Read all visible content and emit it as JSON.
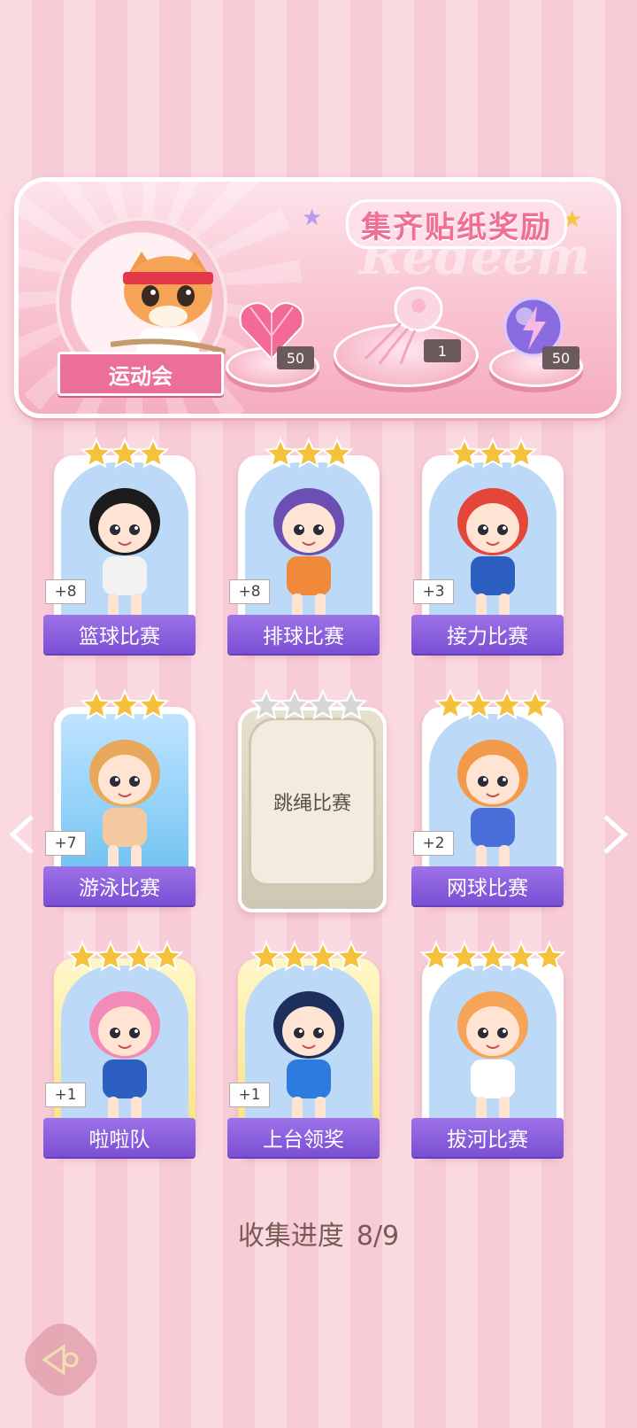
{
  "banner": {
    "title": "集齐贴纸奖励",
    "watermark": "Redeem",
    "event_name": "运动会",
    "rewards": [
      {
        "icon": "pink-heart-gem-icon",
        "count": "50"
      },
      {
        "icon": "jellyfish-ornament-icon",
        "count": "1"
      },
      {
        "icon": "lightning-orb-icon",
        "count": "50"
      }
    ]
  },
  "cards": [
    {
      "name": "篮球比赛",
      "bonus": "+8",
      "stars": 3,
      "filled": 3,
      "state": "collected"
    },
    {
      "name": "排球比赛",
      "bonus": "+8",
      "stars": 3,
      "filled": 3,
      "state": "collected"
    },
    {
      "name": "接力比赛",
      "bonus": "+3",
      "stars": 3,
      "filled": 3,
      "state": "collected"
    },
    {
      "name": "游泳比赛",
      "bonus": "+7",
      "stars": 3,
      "filled": 3,
      "state": "collected"
    },
    {
      "name": "跳绳比赛",
      "bonus": "",
      "stars": 4,
      "filled": 0,
      "state": "locked"
    },
    {
      "name": "网球比赛",
      "bonus": "+2",
      "stars": 4,
      "filled": 4,
      "state": "collected"
    },
    {
      "name": "啦啦队",
      "bonus": "+1",
      "stars": 4,
      "filled": 4,
      "state": "gold"
    },
    {
      "name": "上台领奖",
      "bonus": "+1",
      "stars": 4,
      "filled": 4,
      "state": "gold"
    },
    {
      "name": "拔河比赛",
      "bonus": "",
      "stars": 5,
      "filled": 5,
      "state": "collected"
    }
  ],
  "progress": {
    "label": "收集进度",
    "value": "8/9"
  },
  "colors": {
    "accent": "#ef6f96",
    "label_purple": "#7a4fd4",
    "star_gold": "#f6c13a"
  }
}
